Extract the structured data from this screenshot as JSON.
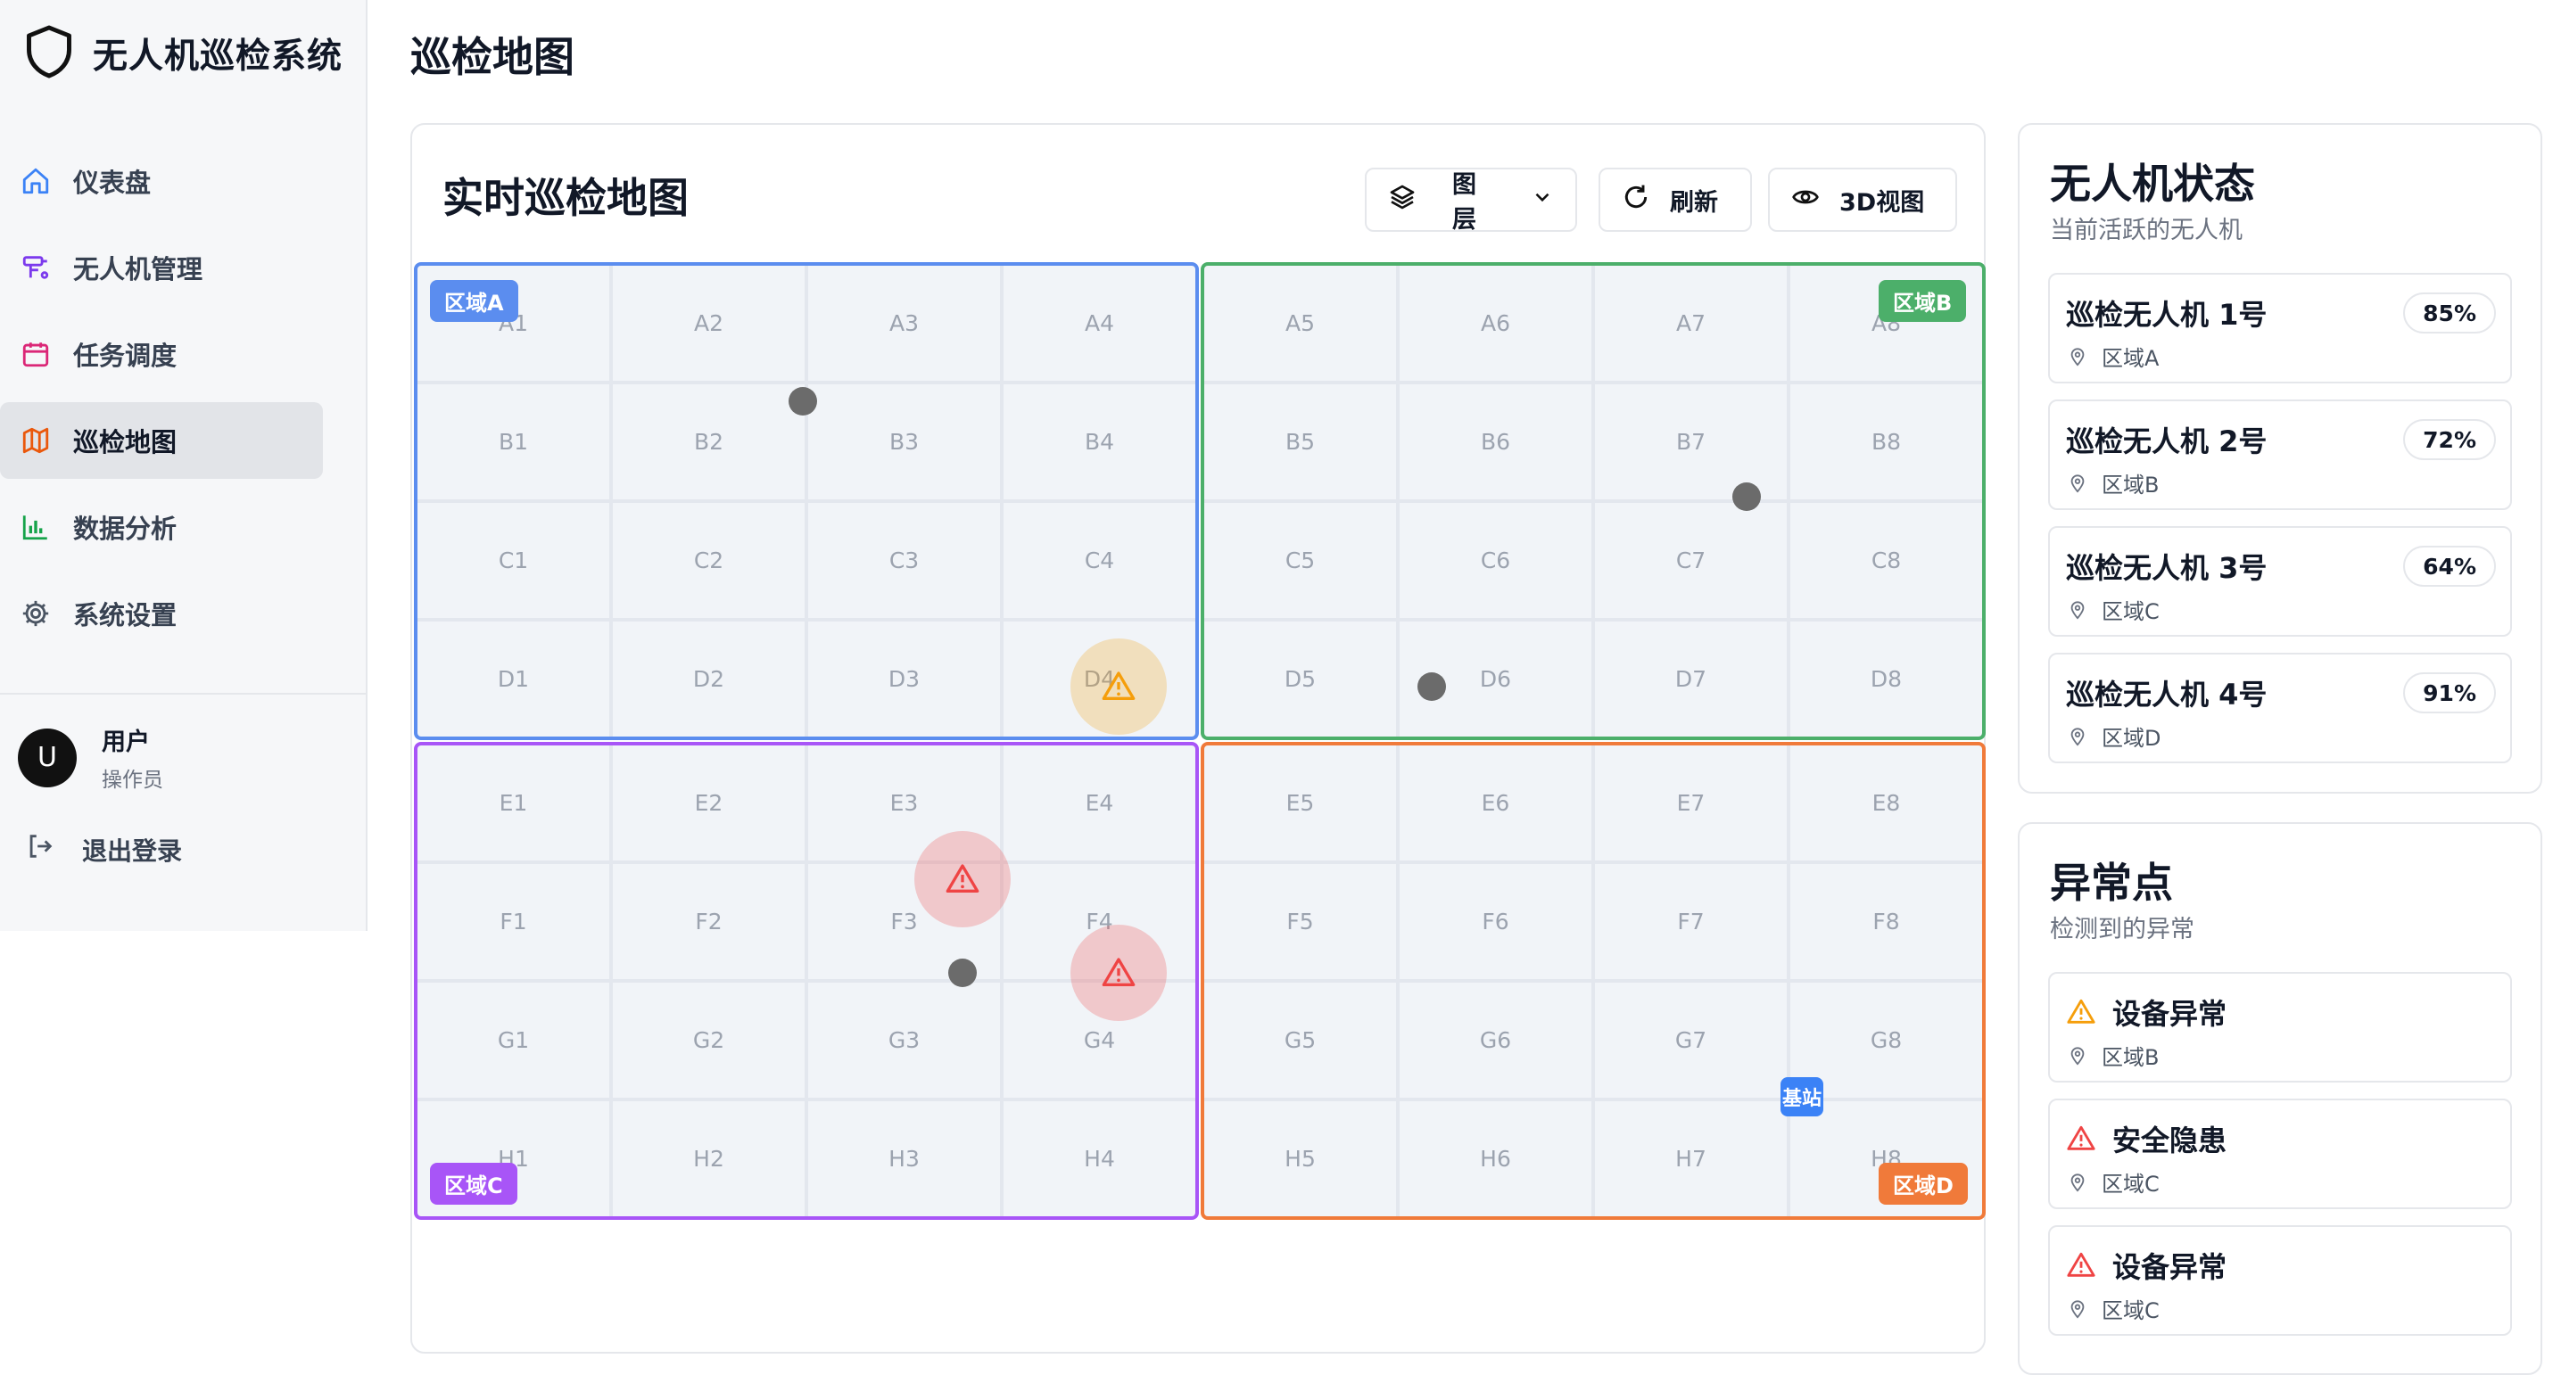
{
  "app": {
    "title": "无人机巡检系统"
  },
  "sidebar": {
    "items": [
      {
        "label": "仪表盘",
        "icon": "home-icon"
      },
      {
        "label": "无人机管理",
        "icon": "drone-icon"
      },
      {
        "label": "任务调度",
        "icon": "calendar-icon"
      },
      {
        "label": "巡检地图",
        "icon": "map-icon",
        "active": true
      },
      {
        "label": "数据分析",
        "icon": "bar-chart-icon"
      },
      {
        "label": "系统设置",
        "icon": "gear-icon"
      }
    ],
    "user": {
      "initial": "U",
      "name": "用户",
      "role": "操作员"
    },
    "logout_label": "退出登录"
  },
  "page": {
    "title": "巡检地图"
  },
  "map": {
    "title": "实时巡检地图",
    "buttons": {
      "layers": "图层",
      "refresh": "刷新",
      "view3d": "3D视图"
    },
    "zones": [
      {
        "label": "区域A",
        "color": "#5b8def"
      },
      {
        "label": "区域B",
        "color": "#4caf6a"
      },
      {
        "label": "区域C",
        "color": "#a855f7"
      },
      {
        "label": "区域D",
        "color": "#f07a3a"
      }
    ],
    "rows": [
      [
        "A1",
        "A2",
        "A3",
        "A4",
        "A5",
        "A6",
        "A7",
        "A8"
      ],
      [
        "B1",
        "B2",
        "B3",
        "B4",
        "B5",
        "B6",
        "B7",
        "B8"
      ],
      [
        "C1",
        "C2",
        "C3",
        "C4",
        "C5",
        "C6",
        "C7",
        "C8"
      ],
      [
        "D1",
        "D2",
        "D3",
        "D4",
        "D5",
        "D6",
        "D7",
        "D8"
      ],
      [
        "E1",
        "E2",
        "E3",
        "E4",
        "E5",
        "E6",
        "E7",
        "E8"
      ],
      [
        "F1",
        "F2",
        "F3",
        "F4",
        "F5",
        "F6",
        "F7",
        "F8"
      ],
      [
        "G1",
        "G2",
        "G3",
        "G4",
        "G5",
        "G6",
        "G7",
        "G8"
      ],
      [
        "H1",
        "H2",
        "H3",
        "H4",
        "H5",
        "H6",
        "H7",
        "H8"
      ]
    ],
    "base_label": "基站"
  },
  "drones_panel": {
    "title": "无人机状态",
    "subtitle": "当前活跃的无人机",
    "items": [
      {
        "name": "巡检无人机 1号",
        "zone": "区域A",
        "battery": "85%"
      },
      {
        "name": "巡检无人机 2号",
        "zone": "区域B",
        "battery": "72%"
      },
      {
        "name": "巡检无人机 3号",
        "zone": "区域C",
        "battery": "64%"
      },
      {
        "name": "巡检无人机 4号",
        "zone": "区域D",
        "battery": "91%"
      }
    ]
  },
  "anomaly_panel": {
    "title": "异常点",
    "subtitle": "检测到的异常",
    "items": [
      {
        "type": "设备异常",
        "zone": "区域B",
        "color": "#f59e0b"
      },
      {
        "type": "安全隐患",
        "zone": "区域C",
        "color": "#ef4444"
      },
      {
        "type": "设备异常",
        "zone": "区域C",
        "color": "#ef4444"
      }
    ]
  }
}
